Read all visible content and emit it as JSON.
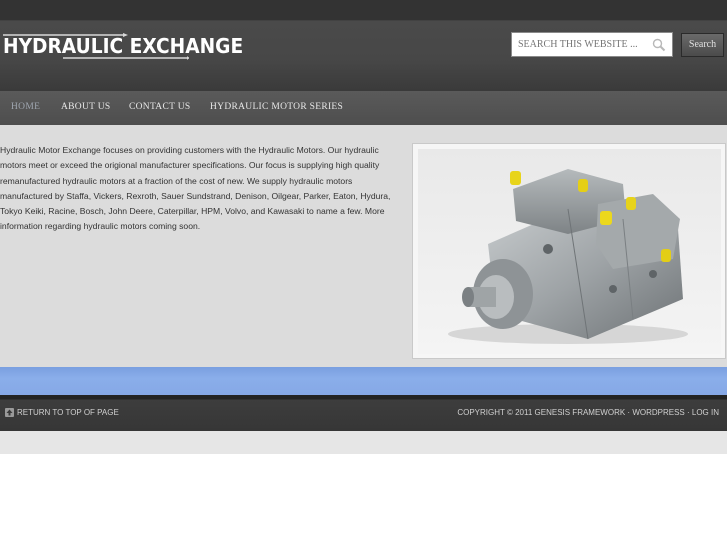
{
  "header": {
    "logo_text": "HYDRAULIC EXCHANGE",
    "search_placeholder": "SEARCH THIS WEBSITE ...",
    "search_button": "Search"
  },
  "nav": {
    "items": [
      {
        "label": "HOME",
        "active": true
      },
      {
        "label": "ABOUT US",
        "active": false
      },
      {
        "label": "CONTACT US",
        "active": false
      },
      {
        "label": "HYDRAULIC MOTOR SERIES",
        "active": false
      }
    ]
  },
  "main": {
    "intro": "Hydraulic Motor Exchange focuses on providing customers with the Hydraulic Motors. Our hydraulic motors meet or exceed the origional manufacturer specifications.  Our focus is supplying high quality remanufactured hydraulic motors at a fraction of the cost of new.  We supply hydraulic motors manufactured by Staffa, Vickers, Rexroth, Sauer Sundstrand, Denison, Oilgear, Parker, Eaton, Hydura, Tokyo Keiki, Racine, Bosch, John Deere, Caterpillar, HPM, Volvo, and Kawasaki to name a few. More information regarding hydraulic motors coming soon.",
    "image_subject": "hydraulic-pump-photo"
  },
  "footer": {
    "return_top": "RETURN TO TOP OF PAGE",
    "copyright": "COPYRIGHT © 2011",
    "framework": "GENESIS FRAMEWORK",
    "sep": " · ",
    "wordpress": "WORDPRESS",
    "login": "LOG IN"
  },
  "colors": {
    "header_bg": "#474747",
    "nav_bg": "#555555",
    "content_bg": "#dcdcdc",
    "accent_bar": "#86a8e6",
    "footer_bg": "#363636"
  }
}
